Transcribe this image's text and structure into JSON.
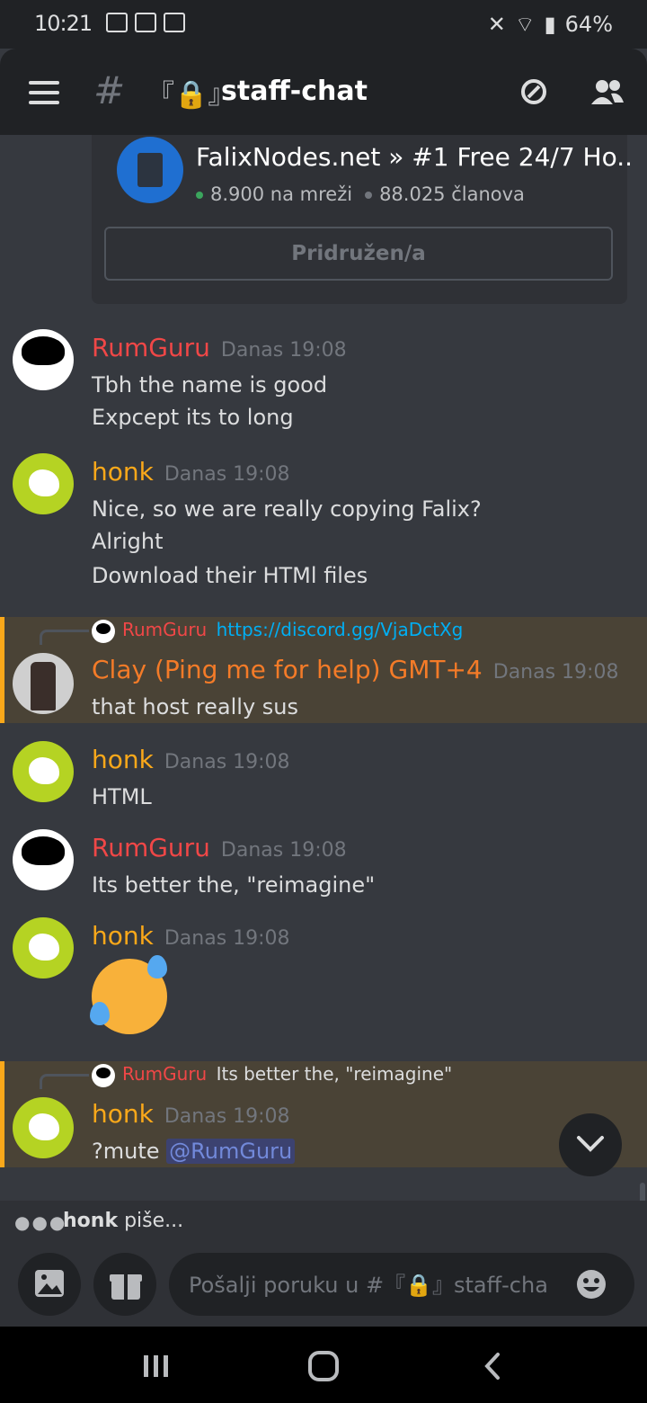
{
  "status_bar": {
    "time": "10:21",
    "battery": "64%"
  },
  "header": {
    "channel_name": "staff-chat"
  },
  "invite": {
    "server_name": "FalixNodes.net » #1 Free 24/7 Ho..",
    "online": "8.900 na mreži",
    "members": "88.025 članova",
    "button_label": "Pridružen/a"
  },
  "messages": [
    {
      "author": "RumGuru",
      "author_color": "#f04747",
      "time": "Danas 19:08",
      "lines": [
        "Tbh the name is good",
        "Expcept its to long"
      ]
    },
    {
      "author": "honk",
      "author_color": "#faa81a",
      "time": "Danas 19:08",
      "lines": [
        "Nice, so we are really copying Falix?",
        "Alright",
        "Download their HTMl files"
      ]
    },
    {
      "reply_author": "RumGuru",
      "reply_text": "https://discord.gg/VjaDctXg",
      "author": "Clay (Ping me for help) GMT+4",
      "author_color": "#f47b28",
      "time": "Danas 19:08",
      "lines": [
        "that host really sus"
      ]
    },
    {
      "author": "honk",
      "author_color": "#faa81a",
      "time": "Danas 19:08",
      "lines": [
        "HTML"
      ]
    },
    {
      "author": "RumGuru",
      "author_color": "#f04747",
      "time": "Danas 19:08",
      "lines": [
        "Its better the, \"reimagine\""
      ]
    },
    {
      "author": "honk",
      "author_color": "#faa81a",
      "time": "Danas 19:08",
      "emoji": "rolling-on-floor-laughing"
    },
    {
      "reply_author": "RumGuru",
      "reply_text": "Its better the, \"reimagine\"",
      "author": "honk",
      "author_color": "#faa81a",
      "time": "Danas 19:08",
      "lines": [
        "?mute"
      ],
      "mention": "@RumGuru"
    }
  ],
  "typing": {
    "user": "honk",
    "suffix": "piše..."
  },
  "composer": {
    "placeholder": "Pošalji poruku u #『🔒』staff-chat"
  }
}
